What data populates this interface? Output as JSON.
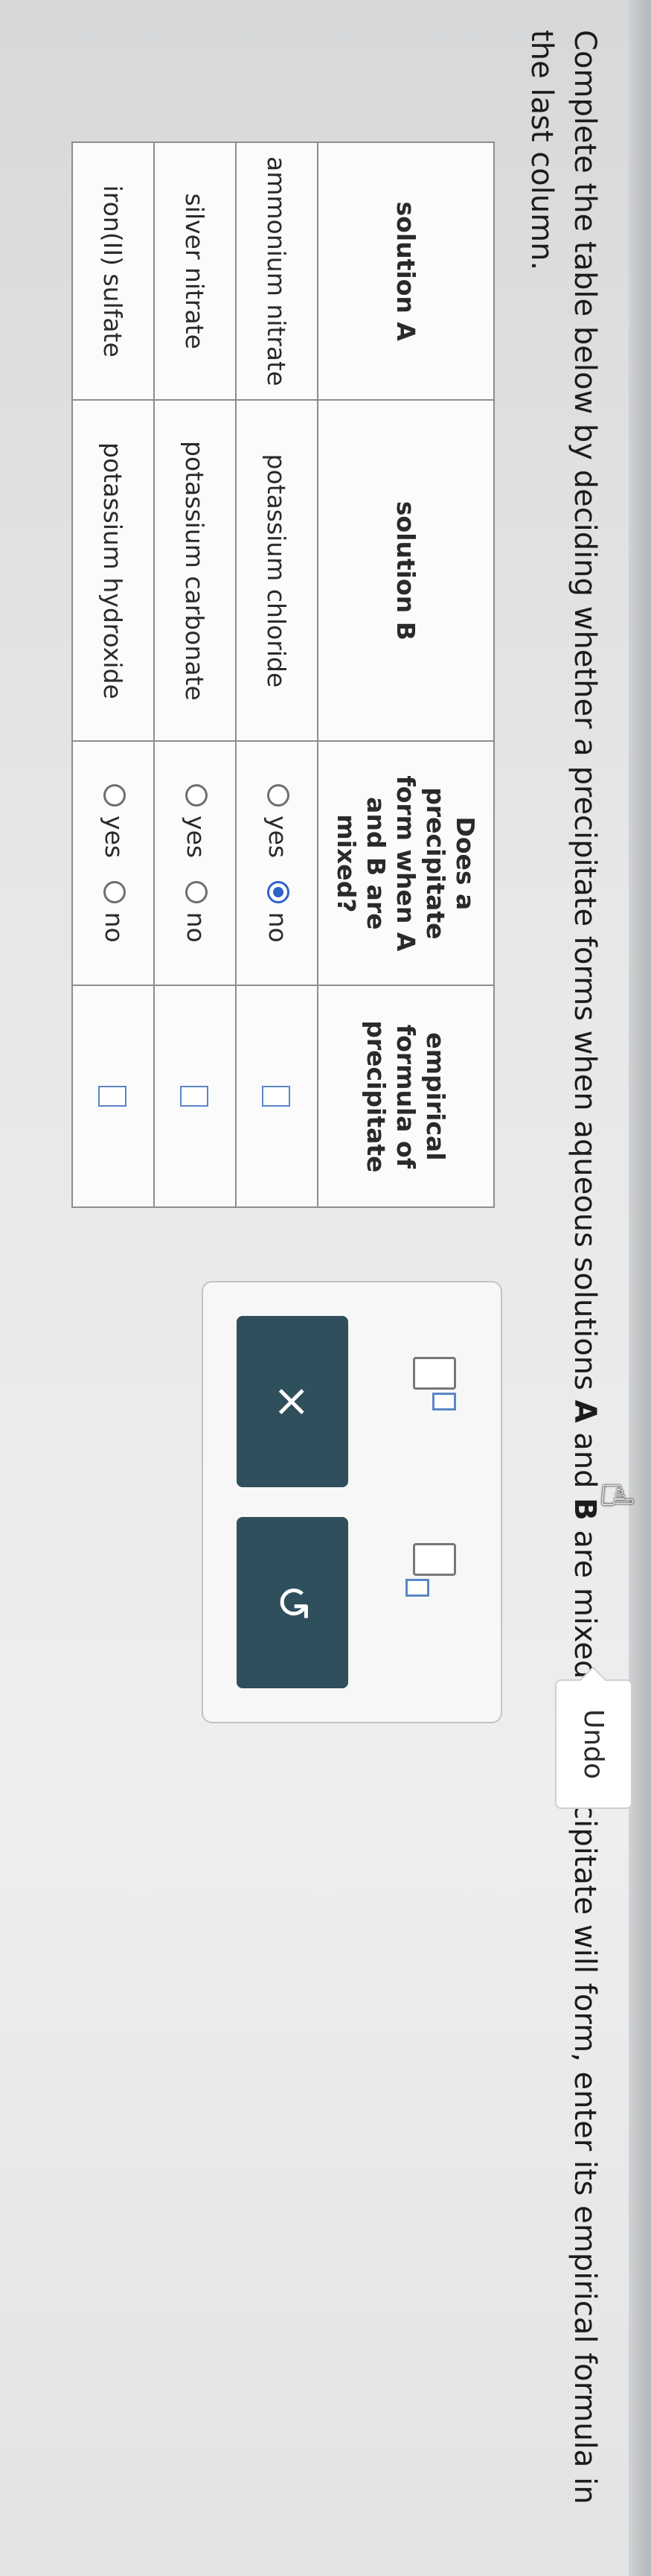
{
  "instruction": {
    "part1": "Complete the table below by deciding whether a precipitate forms when aqueous solutions ",
    "a": "A",
    "part2": " and ",
    "b": "B",
    "part3": " are mixed. If a precipitate will form, enter its empirical formula in the last column."
  },
  "table": {
    "headers": [
      "solution A",
      "solution B",
      "Does a precipitate form when A and B are mixed?",
      "empirical formula of precipitate"
    ],
    "rows": [
      {
        "solution_a": "ammonium nitrate",
        "solution_b": "potassium chloride",
        "yes_label": "yes",
        "no_label": "no",
        "selected": "no"
      },
      {
        "solution_a": "silver nitrate",
        "solution_b": "potassium carbonate",
        "yes_label": "yes",
        "no_label": "no",
        "selected": ""
      },
      {
        "solution_a": "iron(II) sulfate",
        "solution_b": "potassium hydroxide",
        "yes_label": "yes",
        "no_label": "no",
        "selected": ""
      }
    ]
  },
  "panel": {
    "clear_symbol": "×",
    "undo_symbol": "↺",
    "tooltip": "Undo"
  },
  "colors": {
    "selected_radio": "#2f64c6",
    "panel_button": "#2e4f5b",
    "input_border": "#5b86c8"
  }
}
